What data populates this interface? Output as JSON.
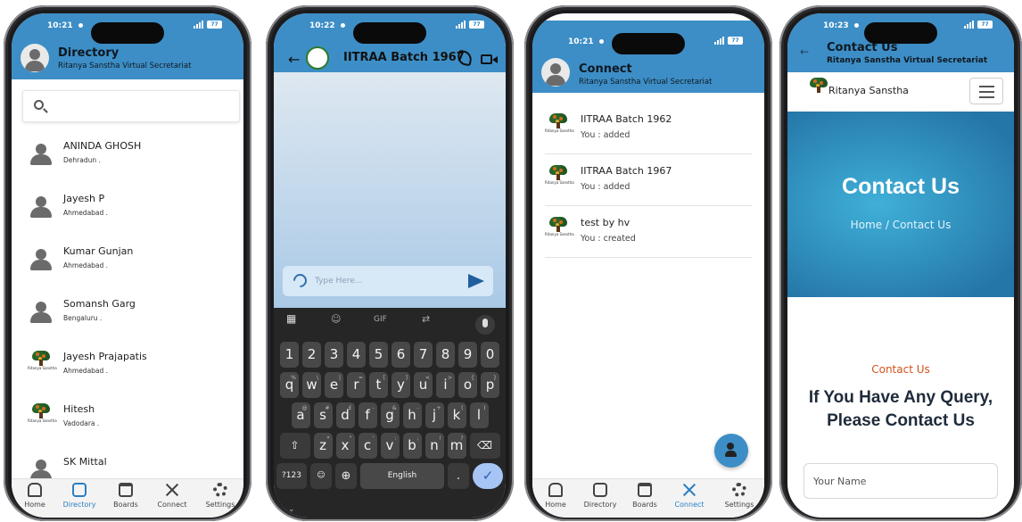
{
  "phones": [
    {
      "status_time": "10:21",
      "battery": "77",
      "header": {
        "title": "Directory",
        "subtitle": "Ritanya Sanstha Virtual Secretariat"
      },
      "search_placeholder": "",
      "members": [
        {
          "name": "ANINDA GHOSH",
          "city": "Dehradun ."
        },
        {
          "name": "Jayesh P",
          "city": "Ahmedabad ."
        },
        {
          "name": "Kumar Gunjan",
          "city": "Ahmedabad ."
        },
        {
          "name": "Somansh Garg",
          "city": "Bengaluru ."
        },
        {
          "name": "Jayesh Prajapatis",
          "city": "Ahmedabad ."
        },
        {
          "name": "Hitesh",
          "city": "Vadodara ."
        },
        {
          "name": "SK Mittal",
          "city": ""
        }
      ],
      "tree_logo_text": "Ritanya Sanstha",
      "nav": [
        "Home",
        "Directory",
        "Boards",
        "Connect",
        "Settings"
      ],
      "nav_active": "Directory"
    },
    {
      "status_time": "10:22",
      "battery": "77",
      "chat_title": "IITRAA Batch 1967",
      "input_placeholder": "Type Here...",
      "keyboard": {
        "toolbar": [
          "GIF"
        ],
        "row1": [
          [
            "1",
            ""
          ],
          [
            "2",
            ""
          ],
          [
            "3",
            ""
          ],
          [
            "4",
            ""
          ],
          [
            "5",
            ""
          ],
          [
            "6",
            ""
          ],
          [
            "7",
            ""
          ],
          [
            "8",
            ""
          ],
          [
            "9",
            ""
          ],
          [
            "0",
            ""
          ]
        ],
        "row2": [
          [
            "q",
            "%"
          ],
          [
            "w",
            "\\"
          ],
          [
            "e",
            "|"
          ],
          [
            "r",
            "="
          ],
          [
            "t",
            "["
          ],
          [
            "y",
            "]"
          ],
          [
            "u",
            "<"
          ],
          [
            "i",
            ">"
          ],
          [
            "o",
            "{"
          ],
          [
            "p",
            "}"
          ]
        ],
        "row3": [
          [
            "a",
            "@"
          ],
          [
            "s",
            "#"
          ],
          [
            "d",
            "£"
          ],
          [
            "f",
            "-"
          ],
          [
            "g",
            "&"
          ],
          [
            "h",
            "-"
          ],
          [
            "j",
            "+"
          ],
          [
            "k",
            "("
          ],
          [
            "l",
            ")"
          ]
        ],
        "row4": [
          [
            "z",
            "*"
          ],
          [
            "x",
            "\""
          ],
          [
            "c",
            "'"
          ],
          [
            "v",
            ":"
          ],
          [
            "b",
            ";"
          ],
          [
            "n",
            "!"
          ],
          [
            "m",
            "?"
          ]
        ],
        "bottom": {
          "sym": "?123",
          "space": "English",
          "dot": "."
        }
      }
    },
    {
      "status_time": "10:21",
      "battery": "77",
      "header": {
        "title": "Connect",
        "subtitle": "Ritanya Sanstha Virtual Secretariat"
      },
      "chats": [
        {
          "name": "IITRAA Batch 1962",
          "status": "You : added"
        },
        {
          "name": "IITRAA Batch 1967",
          "status": "You : added"
        },
        {
          "name": "test by hv",
          "status": "You : created"
        }
      ],
      "nav": [
        "Home",
        "Directory",
        "Boards",
        "Connect",
        "Settings"
      ],
      "nav_active": "Connect"
    },
    {
      "status_time": "10:23",
      "battery": "77",
      "header": {
        "title": "Contact Us",
        "subtitle": "Ritanya Sanstha Virtual Secretariat"
      },
      "site_brand": "Ritanya Sanstha",
      "hero_title": "Contact Us",
      "breadcrumb": "Home / Contact Us",
      "contact_tag": "Contact Us",
      "contact_heading": "If You Have Any Query, Please Contact Us",
      "name_placeholder": "Your Name"
    }
  ],
  "colors": {
    "header_blue": "#3d8ec6",
    "active_blue": "#2a7fc4",
    "accent_orange": "#d2521a"
  }
}
